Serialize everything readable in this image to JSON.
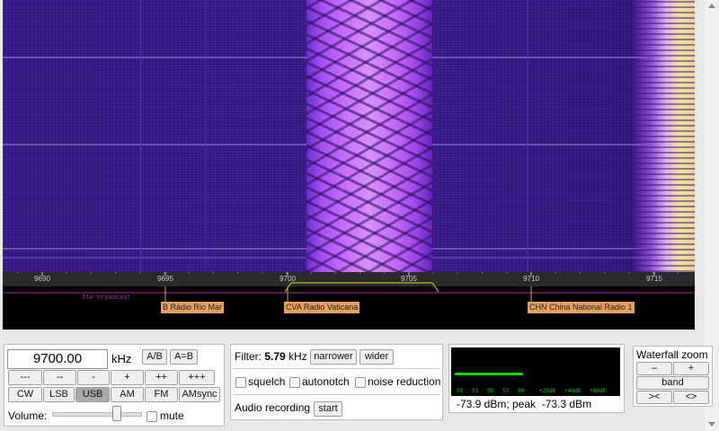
{
  "spectrum": {
    "freq_ticks": [
      "9690",
      "9695",
      "9700",
      "9705",
      "9710",
      "9715"
    ],
    "band_label": "31m broadcast",
    "stations": [
      {
        "label": "B Rádio Rio Mar"
      },
      {
        "label": "CVA Radio Vaticana"
      },
      {
        "label": "CHN China National Radio 1"
      }
    ]
  },
  "frequency": {
    "value": "9700.00",
    "unit": "kHz",
    "ab_label": "A/B",
    "a_eq_b_label": "A=B"
  },
  "step_buttons": [
    "---",
    "--",
    "-",
    "+",
    "++",
    "+++"
  ],
  "modes": [
    {
      "label": "CW",
      "active": false
    },
    {
      "label": "LSB",
      "active": false
    },
    {
      "label": "USB",
      "active": true
    },
    {
      "label": "AM",
      "active": false
    },
    {
      "label": "FM",
      "active": false
    },
    {
      "label": "AMsync",
      "active": false
    }
  ],
  "volume": {
    "label": "Volume:",
    "mute_label": "mute",
    "level": 0.72
  },
  "filter": {
    "label": "Filter:",
    "value": "5.79",
    "unit": "kHz",
    "narrower_label": "narrower",
    "wider_label": "wider"
  },
  "options": {
    "squelch": "squelch",
    "autonotch": "autonotch",
    "noise_reduction": "noise reduction"
  },
  "audio_recording": {
    "label": "Audio recording",
    "start_label": "start"
  },
  "smeter": {
    "scale_labels": [
      "S1",
      "S3",
      "S5",
      "S7",
      "S9",
      "+20dB",
      "+40dB",
      "+60dB"
    ],
    "readout": "-73.9 dBm; peak  -73.3 dBm",
    "bar_color": "#00dd00"
  },
  "waterfall_zoom": {
    "title": "Waterfall zoom",
    "minus": "–",
    "plus": "+",
    "band": "band",
    "left": "><",
    "right": "<>"
  },
  "colors": {
    "waterfall": "#3a1a8a",
    "signal": "#c060ff",
    "station_tag": "#e8a060",
    "band_line": "#b030a0",
    "passband": "#e0e000"
  }
}
